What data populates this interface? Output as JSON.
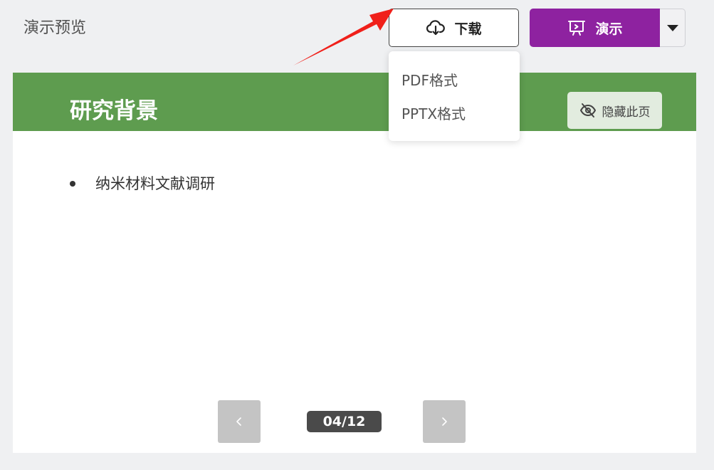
{
  "header": {
    "title": "演示预览",
    "download_label": "下载",
    "present_label": "演示"
  },
  "download_menu": {
    "items": [
      "PDF格式",
      "PPTX格式"
    ]
  },
  "slide": {
    "title": "研究背景",
    "hide_label": "隐藏此页",
    "bullets": [
      "纳米材料文献调研"
    ]
  },
  "pagination": {
    "current": "04/12"
  },
  "colors": {
    "present_accent": "#8e22a0",
    "slide_header": "#5e9c4f",
    "annotation_arrow": "#f0201a"
  }
}
